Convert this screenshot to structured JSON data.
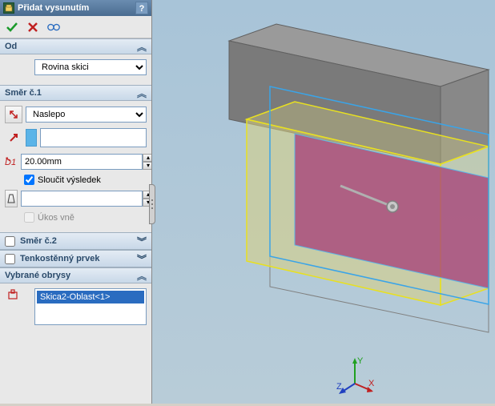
{
  "title": "Přidat vysunutím",
  "sections": {
    "from": {
      "label": "Od",
      "value": "Rovina skici"
    },
    "dir1": {
      "label": "Směr č.1",
      "end_condition": "Naslepo",
      "depth": "20.00mm",
      "merge_label": "Sloučit výsledek",
      "merge_checked": true,
      "draft_label": "Úkos vně",
      "draft_checked": false
    },
    "dir2": {
      "label": "Směr č.2",
      "checked": false
    },
    "thin": {
      "label": "Tenkostěnný prvek",
      "checked": false
    },
    "contours": {
      "label": "Vybrané obrysy",
      "item": "Skica2-Oblast<1>"
    }
  },
  "triad": {
    "x": "X",
    "y": "Y",
    "z": "Z"
  }
}
